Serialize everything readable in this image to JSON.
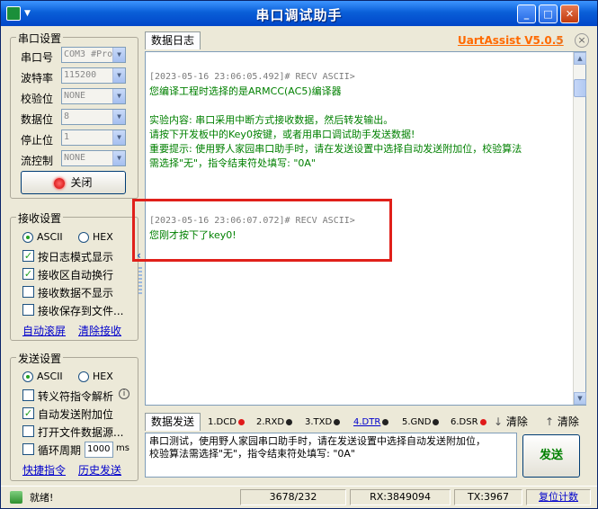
{
  "window": {
    "title": "串口调试助手"
  },
  "serial_settings": {
    "group_title": "串口设置",
    "port_label": "串口号",
    "port_value": "COM3 #Pro",
    "baud_label": "波特率",
    "baud_value": "115200",
    "parity_label": "校验位",
    "parity_value": "NONE",
    "databits_label": "数据位",
    "databits_value": "8",
    "stopbits_label": "停止位",
    "stopbits_value": "1",
    "flow_label": "流控制",
    "flow_value": "NONE",
    "close_button": "关闭"
  },
  "receive_settings": {
    "group_title": "接收设置",
    "ascii": "ASCII",
    "hex": "HEX",
    "opt_log_mode": "按日志模式显示",
    "opt_auto_wrap": "接收区自动换行",
    "opt_no_display": "接收数据不显示",
    "opt_save_file": "接收保存到文件...",
    "link_auto_clear": "自动滚屏",
    "link_clear_recv": "清除接收"
  },
  "send_settings": {
    "group_title": "发送设置",
    "ascii": "ASCII",
    "hex": "HEX",
    "opt_escape": "转义符指令解析",
    "opt_auto_append": "自动发送附加位",
    "opt_open_file": "打开文件数据源...",
    "opt_cycle": "循环周期",
    "cycle_value": "1000",
    "cycle_unit": "ms",
    "link_shortcut": "快捷指令",
    "link_history": "历史发送"
  },
  "log": {
    "tab_label": "数据日志",
    "brand": "UartAssist V5.0.5",
    "entries": [
      "[2023-05-16 23:06:05.492]# RECV ASCII>",
      "您编译工程时选择的是ARMCC(AC5)编译器",
      "实验内容: 串口采用中断方式接收数据，然后转发输出。",
      "请按下开发板中的Key0按键，或者用串口调试助手发送数据!",
      "重要提示: 使用野人家园串口助手时，请在发送设置中选择自动发送附加位，校验算法",
      "需选择\"无\"，指令结束符处填写: \"0A\"",
      "[2023-05-16 23:06:07.072]# RECV ASCII>",
      "您刚才按下了key0!"
    ]
  },
  "send": {
    "tab_label": "数据发送",
    "signals": [
      "1.DCD",
      "2.RXD",
      "3.TXD",
      "4.DTR",
      "5.GND",
      "6.DSR"
    ],
    "clear1": "清除",
    "clear2": "清除",
    "text_line1": "串口测试，使用野人家园串口助手时，请在发送设置中选择自动发送附加位，",
    "text_line2": "校验算法需选择\"无\"，指令结束符处填写: \"0A\"",
    "send_button": "发送"
  },
  "status": {
    "ready": "就绪!",
    "counter": "3678/232",
    "rx": "RX:3849094",
    "tx": "TX:3967",
    "reset": "复位计数"
  },
  "colors": {
    "title_bar": "#0a5fd8",
    "log_text": "#008000",
    "highlight": "#e0201a",
    "brand": "#ff6a00"
  }
}
